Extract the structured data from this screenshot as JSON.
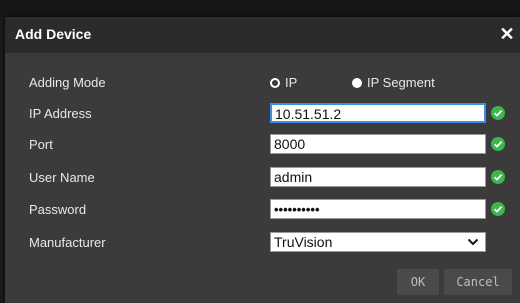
{
  "dialog": {
    "title": "Add Device",
    "close_glyph": "✕"
  },
  "form": {
    "adding_mode": {
      "label": "Adding Mode",
      "options": [
        {
          "label": "IP",
          "selected": true
        },
        {
          "label": "IP Segment",
          "selected": false
        }
      ]
    },
    "ip_address": {
      "label": "IP Address",
      "value": "10.51.51.2",
      "valid": true
    },
    "port": {
      "label": "Port",
      "value": "8000",
      "valid": true
    },
    "user_name": {
      "label": "User Name",
      "value": "admin",
      "valid": true
    },
    "password": {
      "label": "Password",
      "value": "••••••••••",
      "valid": true
    },
    "manufacturer": {
      "label": "Manufacturer",
      "value": "TruVision"
    }
  },
  "buttons": {
    "ok": "OK",
    "cancel": "Cancel"
  },
  "colors": {
    "dialog_bg": "#3b3b3b",
    "titlebar_bg": "#2b2b2b",
    "valid_check": "#3bb64a",
    "focus_border": "#3a8ee6"
  }
}
